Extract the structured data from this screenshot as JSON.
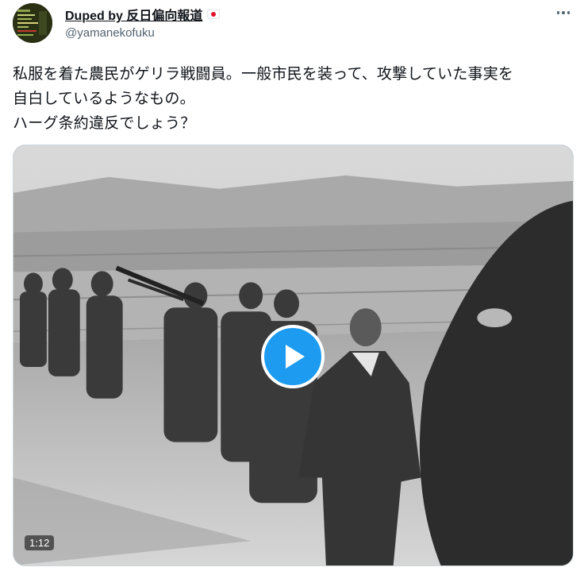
{
  "author": {
    "display_name": "Duped by 反日偏向報道",
    "handle": "@yamanekofuku",
    "flag_icon": "japan-flag-icon",
    "avatar_icon": "avatar-image"
  },
  "more_icon": "more-horizontal-icon",
  "tweet": {
    "lines": [
      "私服を着た農民がゲリラ戦闘員。一般市民を装って、攻撃していた事実を",
      "自白しているようなもの。",
      "ハーグ条約違反でしょう？"
    ]
  },
  "media": {
    "type": "video",
    "duration": "1:12",
    "play_icon": "play-icon",
    "accent_color": "#1d9bf0"
  },
  "colors": {
    "text_primary": "#0f1419",
    "text_secondary": "#536471",
    "border": "#cfd9de"
  }
}
